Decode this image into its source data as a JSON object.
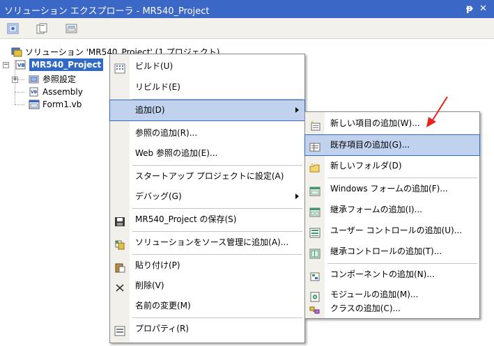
{
  "titlebar": {
    "title": "ソリューション エクスプローラ - MR540_Project",
    "pin_glyph": "ᵽ",
    "close_glyph": "✕"
  },
  "toolbar": {
    "buttons": [
      "properties-icon",
      "show-all-files-icon",
      "refresh-icon"
    ]
  },
  "tree": {
    "solution_label": "ソリューション 'MR540_Project' (1 プロジェクト)",
    "project_label": "MR540_Project",
    "children": [
      {
        "label": "参照設定",
        "icon": "references-icon"
      },
      {
        "label": "Assembly",
        "icon": "vb-file-icon"
      },
      {
        "label": "Form1.vb",
        "icon": "form-file-icon"
      }
    ]
  },
  "context_menu": {
    "items": [
      {
        "label": "ビルド(U)",
        "icon": "build-icon"
      },
      {
        "label": "リビルド(E)",
        "icon": ""
      },
      {
        "label": "追加(D)",
        "icon": "",
        "submenu": true,
        "highlighted": true
      },
      {
        "label": "参照の追加(R)...",
        "icon": ""
      },
      {
        "label": "Web 参照の追加(E)...",
        "icon": ""
      },
      {
        "label": "スタートアップ プロジェクトに設定(A)",
        "icon": ""
      },
      {
        "label": "デバッグ(G)",
        "icon": "",
        "submenu": true
      },
      {
        "label": "MR540_Project の保存(S)",
        "icon": "save-icon"
      },
      {
        "label": "ソリューションをソース管理に追加(A)...",
        "icon": "source-control-icon"
      },
      {
        "label": "貼り付け(P)",
        "icon": "paste-icon"
      },
      {
        "label": "削除(V)",
        "icon": "delete-icon"
      },
      {
        "label": "名前の変更(M)",
        "icon": ""
      },
      {
        "label": "プロパティ(R)",
        "icon": "properties-icon"
      }
    ]
  },
  "submenu": {
    "items": [
      {
        "label": "新しい項目の追加(W)...",
        "icon": "new-item-icon"
      },
      {
        "label": "既存項目の追加(G)...",
        "icon": "existing-item-icon",
        "highlighted": true
      },
      {
        "label": "新しいフォルダ(D)",
        "icon": "new-folder-icon"
      },
      {
        "label": "Windows フォームの追加(F)...",
        "icon": "windows-form-icon"
      },
      {
        "label": "継承フォームの追加(I)...",
        "icon": "inherited-form-icon"
      },
      {
        "label": "ユーザー コントロールの追加(U)...",
        "icon": "user-control-icon"
      },
      {
        "label": "継承コントロールの追加(T)...",
        "icon": "inherited-control-icon"
      },
      {
        "label": "コンポーネントの追加(N)...",
        "icon": "component-icon"
      },
      {
        "label": "モジュールの追加(M)...",
        "icon": "module-icon"
      },
      {
        "label": "クラスの追加(C)...",
        "icon": "class-icon"
      }
    ]
  },
  "colors": {
    "titlebar": "#3b67c6",
    "selection": "#316ac5",
    "menu_highlight": "#c1d2ee",
    "annotation_arrow": "#e8221c"
  }
}
